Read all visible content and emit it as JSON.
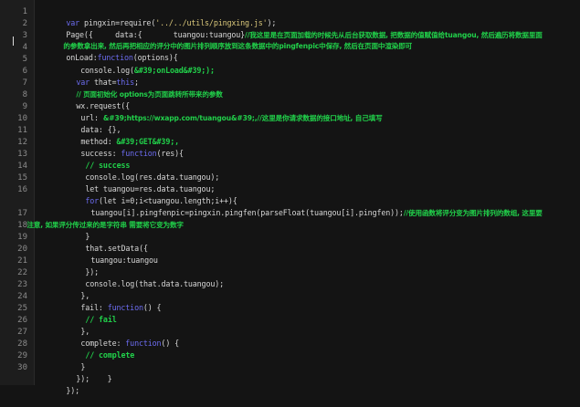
{
  "gutter": {
    "line_numbers": [
      "1",
      "2",
      "3",
      "4",
      "5",
      "6",
      "7",
      "8",
      "9",
      "10",
      "11",
      "12",
      "13",
      "14",
      "15",
      "16",
      "17",
      "18",
      "19",
      "20",
      "21",
      "22",
      "23",
      "24",
      "25",
      "26",
      "27",
      "28",
      "29",
      "30"
    ]
  },
  "code": {
    "l1": {
      "a": "var",
      "b": " pingxin=require(",
      "c": "'../../utils/pingxing.js'",
      "d": ");"
    },
    "l2": {
      "a": "Page({     data:{       tuangou:tuangou}",
      "b": "//我这里是在页面加载的时候先从后台获取数据, 把数据的值赋值给tuangou, 然后遍历将数据里面"
    },
    "l2w": {
      "a": "的参数拿出来, 然后再把相应的评分中的图片排列顺序放到这条数据中的pingfenpic中保存, 然后在页面中渲染即可"
    },
    "l3": {
      "a": "onLoad:",
      "b": "function",
      "c": "(options){"
    },
    "l4": {
      "a": "  console.log(",
      "b": "&#39;onLoad&#39;);"
    },
    "l5": {
      "a": "var",
      "b": " that=",
      "c": "this",
      "d": ";"
    },
    "l6": {
      "a": "// 页面初始化 options为页面跳转所带来的参数"
    },
    "l7": {
      "a": "wx.request({"
    },
    "l8": {
      "a": "url: ",
      "b": "&#39;https://wxapp.com/tuangou&#39;,//这里是你请求数据的接口地址, 自己填写"
    },
    "l9": {
      "a": "data: {},"
    },
    "l10": {
      "a": "method: ",
      "b": "&#39;GET&#39;,"
    },
    "l11": {
      "a": "success: ",
      "b": "function",
      "c": "(res){"
    },
    "l12": {
      "a": "// success"
    },
    "l13": {
      "a": "console.log(res.data.tuangou);"
    },
    "l14": {
      "a": "let tuangou=res.data.tuangou;"
    },
    "l15": {
      "a": "for",
      "b": "(let i=0;i<tuangou.length;i++){"
    },
    "l16": {
      "a": "tuangou[i].pingfenpic=pingxin.pingfen(parseFloat(tuangou[i].pingfen));",
      "b": "//使用函数将评分变为图片排列的数组, 这里要"
    },
    "l16w": {
      "a": "注意, 如果评分传过来的是字符串 需要将它变为数字"
    },
    "l17": {
      "a": "}"
    },
    "l18": {
      "a": "that.setData({"
    },
    "l19": {
      "a": "tuangou:tuangou"
    },
    "l20": {
      "a": "});"
    },
    "l21": {
      "a": "console.log(that.data.tuangou);"
    },
    "l22": {
      "a": "},"
    },
    "l23": {
      "a": "fail: ",
      "b": "function",
      "c": "() {"
    },
    "l24": {
      "a": "// fail"
    },
    "l25": {
      "a": "},"
    },
    "l26": {
      "a": "complete: ",
      "b": "function",
      "c": "() {"
    },
    "l27": {
      "a": "// complete"
    },
    "l28": {
      "a": "}"
    },
    "l29": {
      "a": "});    }"
    },
    "l30": {
      "a": "});"
    }
  },
  "colors": {
    "background": "#141414",
    "gutter": "#1d1d1d",
    "keyword": "#6c6cf0",
    "string": "#d9c77a",
    "comment": "#21d04a",
    "text": "#d6d6d6"
  }
}
